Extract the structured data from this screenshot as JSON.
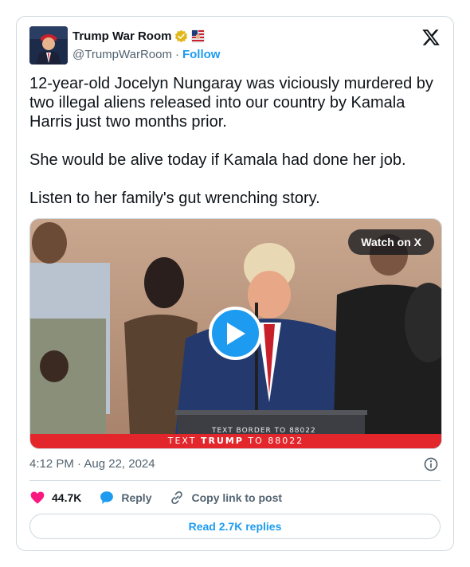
{
  "author": {
    "name": "Trump War Room",
    "handle": "@TrumpWarRoom",
    "separator": "·",
    "follow_label": "Follow",
    "avatar_icon": "profile-photo",
    "verified_icon": "verified-gold-badge",
    "affiliate_icon": "affiliate-flag-badge"
  },
  "tweet": {
    "paragraphs": [
      "12-year-old Jocelyn Nungaray was viciously murdered by two illegal aliens released into our country by Kamala Harris just two months prior.",
      "She would be alive today if Kamala had done her job.",
      "Listen to her family's gut wrenching story."
    ]
  },
  "media": {
    "watch_label": "Watch on X",
    "banner_prefix": "TEXT ",
    "banner_bold": "TRUMP",
    "banner_suffix": " TO 88022",
    "podium_text": "TEXT BORDER TO 88022",
    "play_icon": "play-icon"
  },
  "meta": {
    "timestamp": "4:12 PM · Aug 22, 2024",
    "info_icon": "info-icon"
  },
  "actions": {
    "likes": "44.7K",
    "reply_label": "Reply",
    "copy_label": "Copy link to post"
  },
  "replies_button": "Read 2.7K replies",
  "colors": {
    "accent": "#1d9bf0",
    "like": "#f91880",
    "banner": "#e2262b",
    "text": "#0f1419",
    "secondary": "#536471",
    "border": "#cfd9de"
  }
}
